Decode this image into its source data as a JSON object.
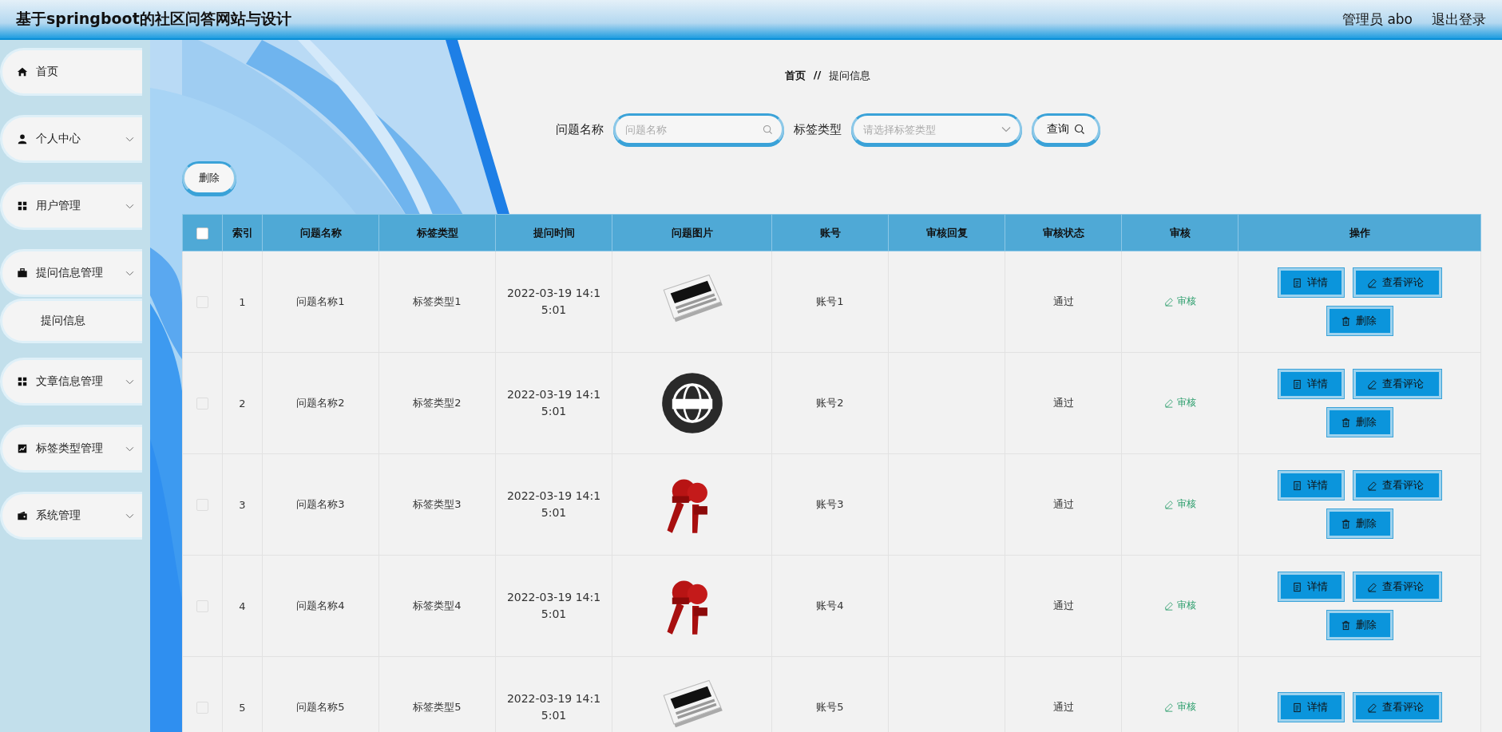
{
  "header": {
    "title": "基于springboot的社区问答网站与设计",
    "user": "管理员 abo",
    "logout": "退出登录"
  },
  "sidebar": {
    "items": [
      {
        "label": "首页",
        "expandable": false
      },
      {
        "label": "个人中心",
        "expandable": true
      },
      {
        "label": "用户管理",
        "expandable": true
      },
      {
        "label": "提问信息管理",
        "expandable": true,
        "children": [
          {
            "label": "提问信息"
          }
        ]
      },
      {
        "label": "文章信息管理",
        "expandable": true
      },
      {
        "label": "标签类型管理",
        "expandable": true
      },
      {
        "label": "系统管理",
        "expandable": true
      }
    ]
  },
  "breadcrumb": {
    "home": "首页",
    "separator": "//",
    "current": "提问信息"
  },
  "search": {
    "name_label": "问题名称",
    "name_placeholder": "问题名称",
    "tag_label": "标签类型",
    "tag_placeholder": "请选择标签类型",
    "button": "查询"
  },
  "delete_button": "删除",
  "table": {
    "select_all": {
      "checked": false
    },
    "columns": [
      "索引",
      "问题名称",
      "标签类型",
      "提问时间",
      "问题图片",
      "账号",
      "审核回复",
      "审核状态",
      "审核",
      "操作"
    ],
    "rows": [
      {
        "checked": false,
        "index": "1",
        "name": "问题名称1",
        "tag": "标签类型1",
        "time": "2022-03-19 14:15:01",
        "image": {
          "kind": "picture"
        },
        "account": "账号1",
        "status": "通过",
        "audit": "审核",
        "actions": [
          {
            "kind": "detail",
            "label": "详情"
          },
          {
            "kind": "comments",
            "label": "查看评论"
          },
          {
            "kind": "delete",
            "label": "删除"
          }
        ]
      },
      {
        "checked": false,
        "index": "2",
        "name": "问题名称2",
        "tag": "标签类型2",
        "time": "2022-03-19 14:15:01",
        "image": {
          "kind": "picture"
        },
        "account": "账号2",
        "status": "通过",
        "audit": "审核",
        "actions": [
          {
            "kind": "detail",
            "label": "详情"
          },
          {
            "kind": "comments",
            "label": "查看评论"
          },
          {
            "kind": "delete",
            "label": "删除"
          }
        ]
      },
      {
        "checked": false,
        "index": "3",
        "name": "问题名称3",
        "tag": "标签类型3",
        "time": "2022-03-19 14:15:01",
        "image": {
          "kind": "picture"
        },
        "account": "账号3",
        "status": "通过",
        "audit": "审核",
        "actions": [
          {
            "kind": "detail",
            "label": "详情"
          },
          {
            "kind": "comments",
            "label": "查看评论"
          },
          {
            "kind": "delete",
            "label": "删除"
          }
        ]
      },
      {
        "checked": false,
        "index": "4",
        "name": "问题名称4",
        "tag": "标签类型4",
        "time": "2022-03-19 14:15:01",
        "image": {
          "kind": "picture"
        },
        "account": "账号4",
        "status": "通过",
        "audit": "审核",
        "actions": [
          {
            "kind": "detail",
            "label": "详情"
          },
          {
            "kind": "comments",
            "label": "查看评论"
          },
          {
            "kind": "delete",
            "label": "删除"
          }
        ]
      },
      {
        "checked": false,
        "index": "5",
        "name": "问题名称5",
        "tag": "标签类型5",
        "time": "2022-03-19 14:15:01",
        "image": {
          "kind": "picture"
        },
        "account": "账号5",
        "status": "通过",
        "audit": "审核",
        "actions": [
          {
            "kind": "detail",
            "label": "详情"
          },
          {
            "kind": "comments",
            "label": "查看评论"
          }
        ]
      }
    ]
  }
}
